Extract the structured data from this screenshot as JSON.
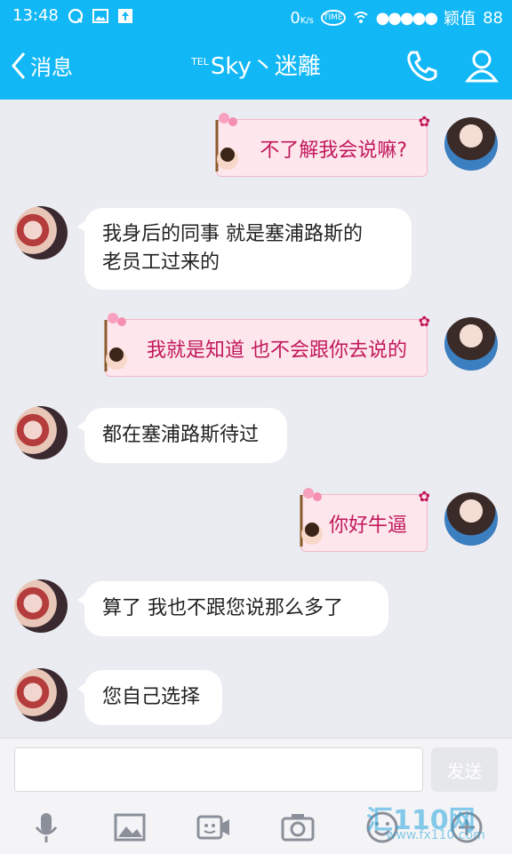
{
  "status": {
    "time": "13:48",
    "net_speed": "0",
    "net_unit": "K/s",
    "sim_label": "TIME",
    "carrier": "颖值",
    "battery": "88"
  },
  "header": {
    "back_label": "消息",
    "title_prefix": "TEL",
    "title": "Sky丶迷離"
  },
  "messages": [
    {
      "side": "right",
      "lines": [
        "不了解我会说嘛?"
      ]
    },
    {
      "side": "left",
      "lines": [
        "我身后的同事 就是塞浦路斯的",
        "老员工过来的"
      ]
    },
    {
      "side": "right",
      "lines": [
        "我就是知道 也不会跟你去说的"
      ]
    },
    {
      "side": "left",
      "lines": [
        "都在塞浦路斯待过"
      ]
    },
    {
      "side": "right",
      "lines": [
        "你好牛逼"
      ]
    },
    {
      "side": "left",
      "lines": [
        "算了 我也不跟您说那么多了"
      ]
    },
    {
      "side": "left",
      "lines": [
        "您自己选择"
      ]
    }
  ],
  "input": {
    "placeholder": "",
    "send_label": "发送"
  },
  "tools": [
    "microphone-icon",
    "image-icon",
    "video-icon",
    "camera-icon",
    "emoji-icon",
    "plus-icon"
  ],
  "watermark": {
    "brand": "汇110网",
    "url": "www.fx110.com"
  },
  "colors": {
    "accent": "#12b7f5",
    "bubble_right_bg": "#fde6ec",
    "bubble_right_text": "#c2185b"
  }
}
